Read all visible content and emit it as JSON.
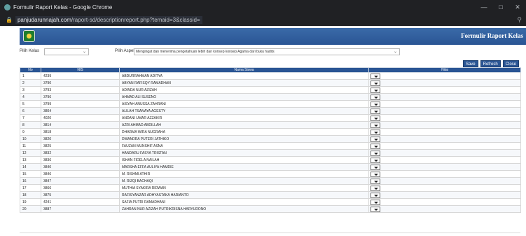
{
  "browser": {
    "window_title": "Formulir Raport Kelas - Google Chrome",
    "url_host": "panjudarunnajah.com",
    "url_path": "/raport-sd/descriptionreport.php?temaid=3&classid="
  },
  "banner": {
    "title": "Formulir Raport Kelas"
  },
  "filters": {
    "kelas_label": "Pilih Kelas",
    "kelas_value": "",
    "aspek_label": "Pilih Aspek",
    "aspek_value": "Mengingat dan menerima pengetahuan lebih dan konsep konsep Agama dari buku hadits"
  },
  "actions": {
    "save": "Save",
    "refresh": "Refresh",
    "close": "Close"
  },
  "table": {
    "headers": [
      "No",
      "NIS",
      "Nama Siswa",
      "Nilai"
    ],
    "rows": [
      {
        "no": "1",
        "nis": "4239",
        "nama": "ABDURRAHMAN ADITYA"
      },
      {
        "no": "2",
        "nis": "3790",
        "nama": "ABYAN RAFISQY RAMADHAN"
      },
      {
        "no": "3",
        "nis": "3793",
        "nama": "ADINDA NUR AZIZAH"
      },
      {
        "no": "4",
        "nis": "3796",
        "nama": "AHMAD ALI SUSENO"
      },
      {
        "no": "5",
        "nis": "3799",
        "nama": "AISYAH ANUSSA ZAHRANI"
      },
      {
        "no": "6",
        "nis": "3804",
        "nama": "ALILAH TSANAYA AGESTY"
      },
      {
        "no": "7",
        "nis": "4020",
        "nama": "ANDANI UMAR AZZAKIR"
      },
      {
        "no": "8",
        "nis": "3814",
        "nama": "AZRI AHMAD ABDILLAH"
      },
      {
        "no": "9",
        "nis": "3818",
        "nama": "DHARMA WIRA NUGRAHA"
      },
      {
        "no": "10",
        "nis": "3820",
        "nama": "DWANDRA PUTERI JATHIKO"
      },
      {
        "no": "11",
        "nis": "3825",
        "nama": "FAUZAN MUNSHIF ASNA"
      },
      {
        "no": "12",
        "nis": "3832",
        "nama": "HANDARU FASYA TRISTAN"
      },
      {
        "no": "13",
        "nis": "3836",
        "nama": "ISHAN FIDELA NAILAH"
      },
      {
        "no": "14",
        "nis": "3840",
        "nama": "MARSHA EFFA AULIYA HAMDIE"
      },
      {
        "no": "15",
        "nis": "3846",
        "nama": "M. RISHMI ATHIR"
      },
      {
        "no": "16",
        "nis": "3847",
        "nama": "M. RIZQI BACHAQI"
      },
      {
        "no": "17",
        "nis": "3866",
        "nama": "MUTHIA SYAKIRA RIDWAN"
      },
      {
        "no": "18",
        "nis": "3875",
        "nama": "RAFISYANZAR ADHYASTAKA HARIANTO"
      },
      {
        "no": "19",
        "nis": "4241",
        "nama": "SAFIA PUTRI RAMADHANI"
      },
      {
        "no": "20",
        "nis": "3887",
        "nama": "ZAHRAN NUR AZIZAH PUTRIKRISNA HARYUDONO"
      }
    ]
  }
}
